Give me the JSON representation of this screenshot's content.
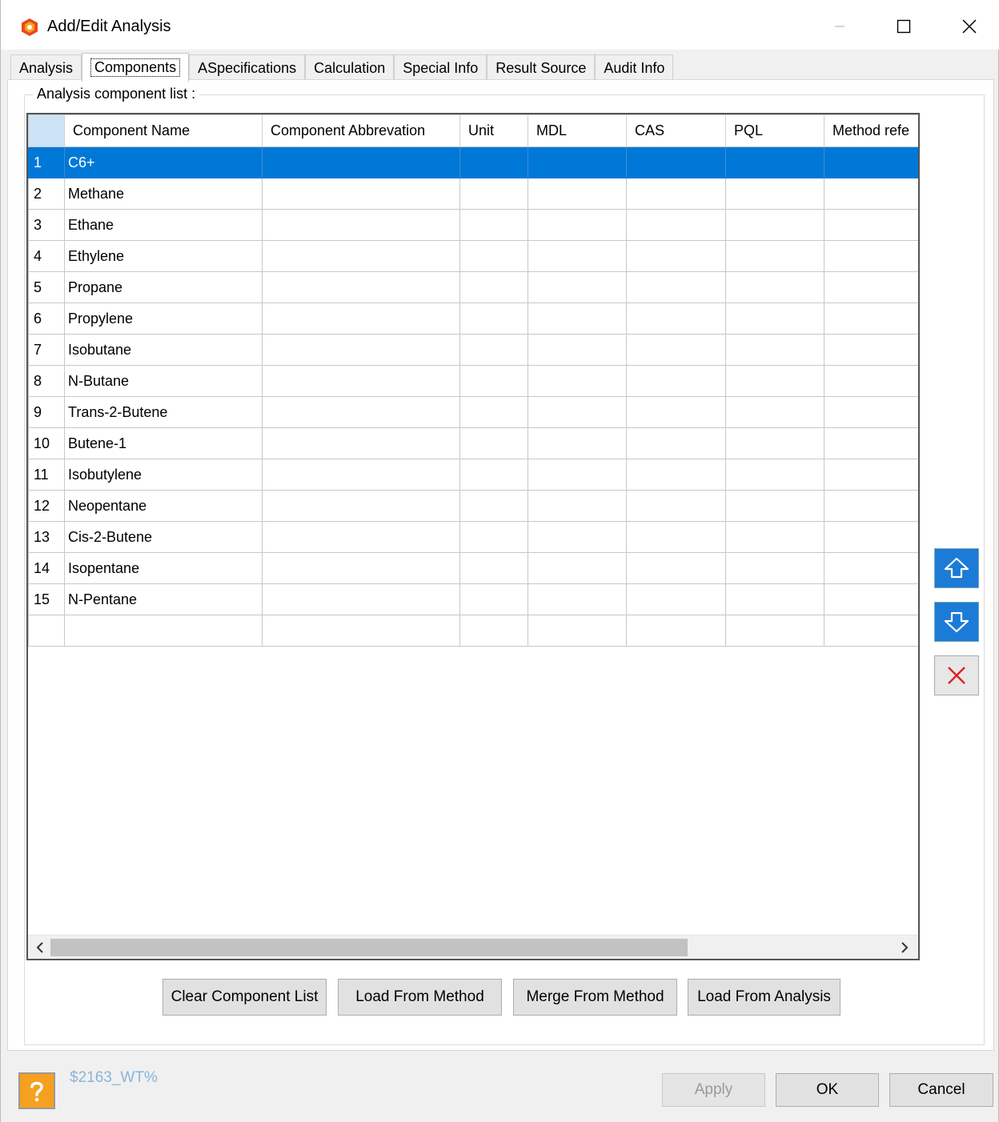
{
  "window": {
    "title": "Add/Edit Analysis",
    "icon": "app-logo-icon"
  },
  "tabs": [
    {
      "label": "Analysis",
      "active": false
    },
    {
      "label": "Components",
      "active": true
    },
    {
      "label": "ASpecifications",
      "active": false
    },
    {
      "label": "Calculation",
      "active": false
    },
    {
      "label": "Special Info",
      "active": false
    },
    {
      "label": "Result Source",
      "active": false
    },
    {
      "label": "Audit Info",
      "active": false
    }
  ],
  "group": {
    "title": "Analysis component list :"
  },
  "table": {
    "columns": [
      "Component Name",
      "Component Abbrevation",
      "Unit",
      "MDL",
      "CAS",
      "PQL",
      "Method refe"
    ],
    "rows": [
      {
        "num": "1",
        "name": "C6+"
      },
      {
        "num": "2",
        "name": "Methane"
      },
      {
        "num": "3",
        "name": "Ethane"
      },
      {
        "num": "4",
        "name": "Ethylene"
      },
      {
        "num": "5",
        "name": "Propane"
      },
      {
        "num": "6",
        "name": "Propylene"
      },
      {
        "num": "7",
        "name": "Isobutane"
      },
      {
        "num": "8",
        "name": "N-Butane"
      },
      {
        "num": "9",
        "name": "Trans-2-Butene"
      },
      {
        "num": "10",
        "name": "Butene-1"
      },
      {
        "num": "11",
        "name": "Isobutylene"
      },
      {
        "num": "12",
        "name": "Neopentane"
      },
      {
        "num": "13",
        "name": "Cis-2-Butene"
      },
      {
        "num": "14",
        "name": "Isopentane"
      },
      {
        "num": "15",
        "name": "N-Pentane"
      },
      {
        "num": "",
        "name": ""
      }
    ],
    "selected_row": 0,
    "scroll_left_icon": "chevron-left-icon",
    "scroll_right_icon": "chevron-right-icon"
  },
  "side_buttons": {
    "move_up_icon": "arrow-up-icon",
    "move_down_icon": "arrow-down-icon",
    "delete_icon": "delete-x-icon"
  },
  "actions": {
    "clear": "Clear Component List",
    "load_method": "Load From Method",
    "merge_method": "Merge From Method",
    "load_analysis": "Load From Analysis"
  },
  "footer": {
    "status_code": "$2163_WT%",
    "apply": "Apply",
    "ok": "OK",
    "cancel": "Cancel",
    "help_icon": "help-question-icon"
  },
  "colors": {
    "selection": "#0078d7",
    "accent_blue": "#1c7bd6",
    "delete_red": "#e02020",
    "help_orange": "#f6a020",
    "status_text": "#8ab4d8"
  }
}
